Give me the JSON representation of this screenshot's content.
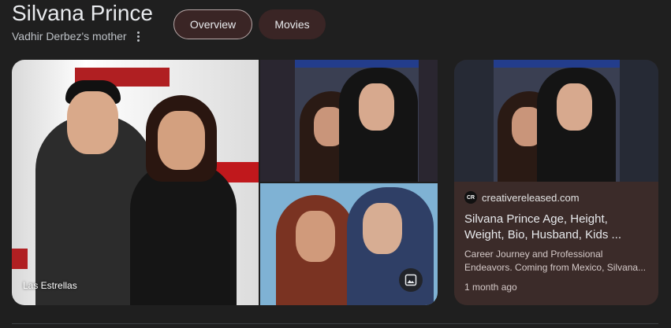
{
  "header": {
    "title": "Silvana Prince",
    "subtitle": "Vadhir Derbez's mother",
    "more_icon": "more-vert-icon"
  },
  "chips": {
    "overview": "Overview",
    "movies": "Movies"
  },
  "images": {
    "main_caption": "Las Estrellas",
    "gallery_icon": "image-icon"
  },
  "result_card": {
    "favicon_text": "CR",
    "source": "creativereleased.com",
    "title": "Silvana Prince Age, Height, Weight, Bio, Husband, Kids ...",
    "snippet": "Career Journey and Professional Endeavors. Coming from Mexico, Silvana...",
    "time": "1 month ago"
  },
  "colors": {
    "background": "#1f1f1f",
    "chip_bg": "#3a2525",
    "card_bg": "#3b2b29"
  }
}
